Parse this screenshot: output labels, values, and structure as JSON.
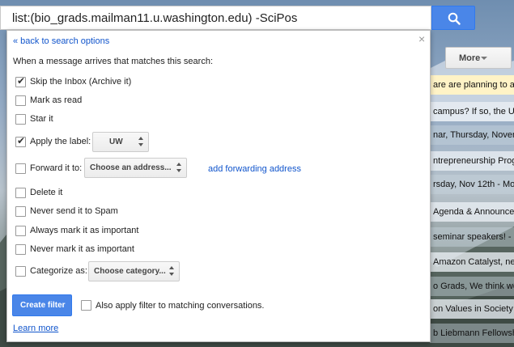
{
  "search": {
    "query": "list:(bio_grads.mailman11.u.washington.edu) -SciPos",
    "button_icon": "search-icon"
  },
  "inbox": {
    "more_label": "More",
    "rows": [
      {
        "text": "are are planning to at",
        "style": "yellow"
      },
      {
        "text": "campus? If so, the U",
        "style": "light"
      },
      {
        "text": "nar, Thursday, Novem",
        "style": "dark"
      },
      {
        "text": "ntrepreneurship Progr",
        "style": "light"
      },
      {
        "text": "rsday, Nov 12th - Mo",
        "style": "dark"
      },
      {
        "text": "Agenda & Announce",
        "style": "light"
      },
      {
        "text": "seminar speakers! - H",
        "style": "dark"
      },
      {
        "text": "Amazon Catalyst, ne",
        "style": "light"
      },
      {
        "text": "o Grads, We think we",
        "style": "dark"
      },
      {
        "text": "on Values in Society",
        "style": "light"
      },
      {
        "text": "b Liebmann Fellowsh",
        "style": "dark"
      }
    ]
  },
  "dialog": {
    "back_link": "« back to search options",
    "close": "×",
    "intro": "When a message arrives that matches this search:",
    "options": {
      "skip_inbox": {
        "label": "Skip the Inbox (Archive it)",
        "checked": true
      },
      "mark_read": {
        "label": "Mark as read",
        "checked": false
      },
      "star": {
        "label": "Star it",
        "checked": false
      },
      "apply_label": {
        "label": "Apply the label:",
        "checked": true,
        "value": "UW"
      },
      "forward": {
        "label": "Forward it to:",
        "checked": false,
        "value": "Choose an address..."
      },
      "delete": {
        "label": "Delete it",
        "checked": false
      },
      "never_spam": {
        "label": "Never send it to Spam",
        "checked": false
      },
      "always_important": {
        "label": "Always mark it as important",
        "checked": false
      },
      "never_important": {
        "label": "Never mark it as important",
        "checked": false
      },
      "categorize": {
        "label": "Categorize as:",
        "checked": false,
        "value": "Choose category..."
      }
    },
    "forward_link": "add forwarding address",
    "create_button": "Create filter",
    "also_apply": {
      "label": "Also apply filter to matching conversations.",
      "checked": false
    },
    "learn_more": "Learn more"
  },
  "colors": {
    "primary_button": "#4a86e8",
    "link": "#1155cc"
  }
}
